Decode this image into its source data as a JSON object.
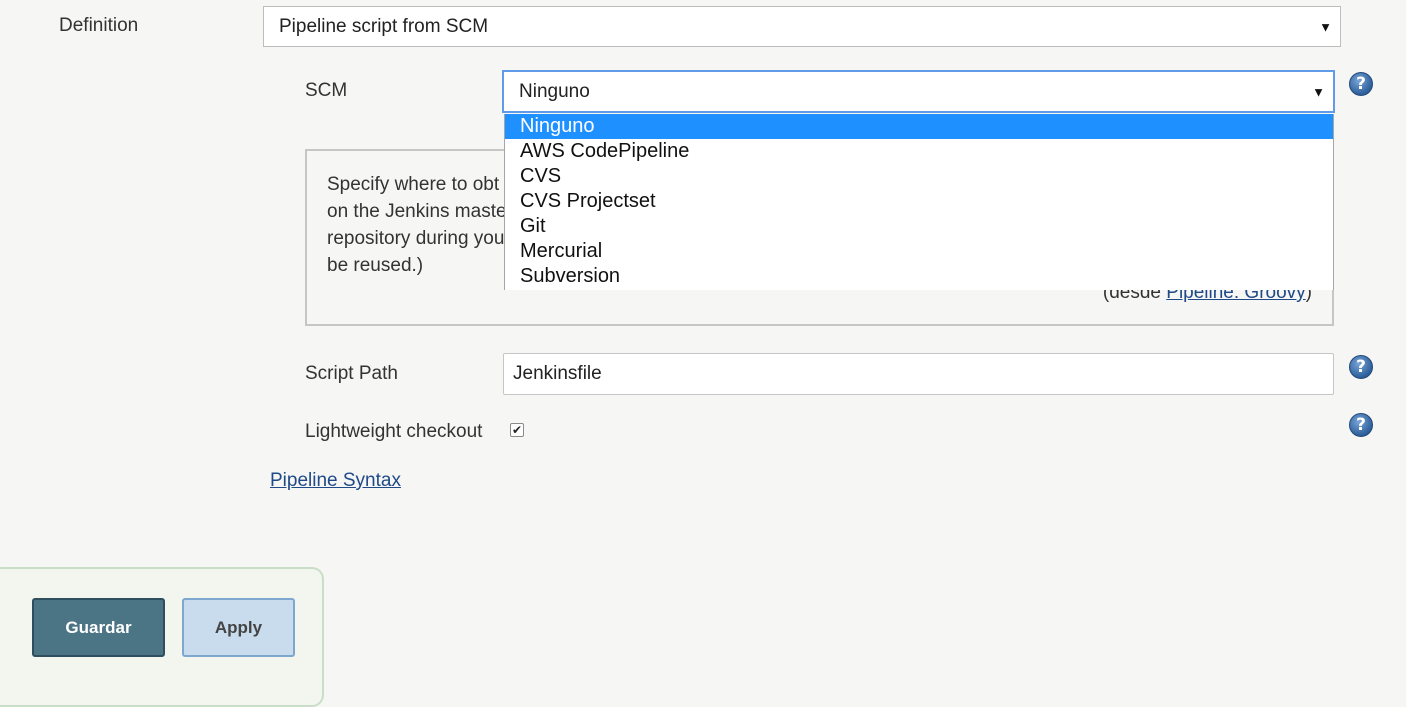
{
  "definition": {
    "label": "Definition",
    "selected": "Pipeline script from SCM"
  },
  "scm": {
    "label": "SCM",
    "selected": "Ninguno",
    "options": [
      "Ninguno",
      "AWS CodePipeline",
      "CVS",
      "CVS Projectset",
      "Git",
      "Mercurial",
      "Subversion"
    ]
  },
  "help_box": {
    "lines": [
      "Specify where to obt",
      "on the Jenkins maste",
      "repository during you",
      "be reused.)"
    ],
    "source_prefix": "(desde ",
    "source_link": "Pipeline: Groovy",
    "source_suffix": ")"
  },
  "script_path": {
    "label": "Script Path",
    "value": "Jenkinsfile"
  },
  "lightweight": {
    "label": "Lightweight checkout",
    "checked": true
  },
  "pipeline_syntax_link": "Pipeline Syntax",
  "buttons": {
    "save": "Guardar",
    "apply": "Apply"
  },
  "icons": {
    "help": "question-mark-icon",
    "dropdown_arrow": "triangle-down-icon",
    "check": "checkmark-icon"
  }
}
